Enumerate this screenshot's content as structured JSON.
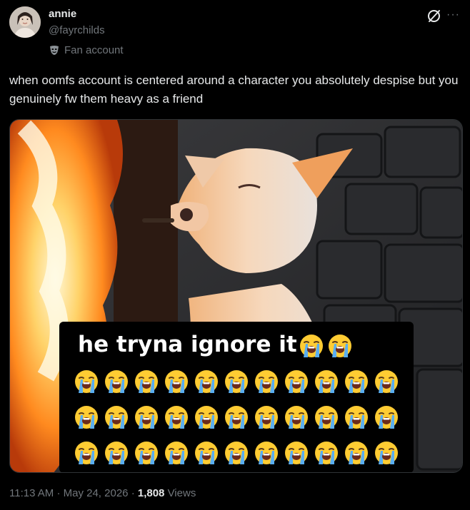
{
  "author": {
    "display_name": "annie",
    "handle": "@fayrchilds",
    "affiliation_label": "Fan account",
    "avatar_icon": "profile-photo",
    "affiliation_icon": "theater-mask-icon"
  },
  "header_icons": {
    "grok": "grok-icon",
    "more": "more-options-icon"
  },
  "tweet": {
    "text": "when oomfs account is centered around a character you absolutely despise but you genuinely fw them heavy as a friend"
  },
  "media": {
    "caption": "he tryna ignore it",
    "emoji": "loudly-crying-face",
    "inline_emoji_count": 2,
    "grid_rows": 3,
    "grid_cols": 11
  },
  "meta": {
    "time": "11:13 AM",
    "separator": "·",
    "date": "May 24, 2026",
    "views_count": "1,808",
    "views_label": "Views"
  },
  "colors": {
    "background": "#000000",
    "text_primary": "#e7e9ea",
    "text_secondary": "#71767b",
    "border": "#2f3336",
    "emoji_yellow": "#ffcc33",
    "tears_blue": "#5aaef0"
  }
}
